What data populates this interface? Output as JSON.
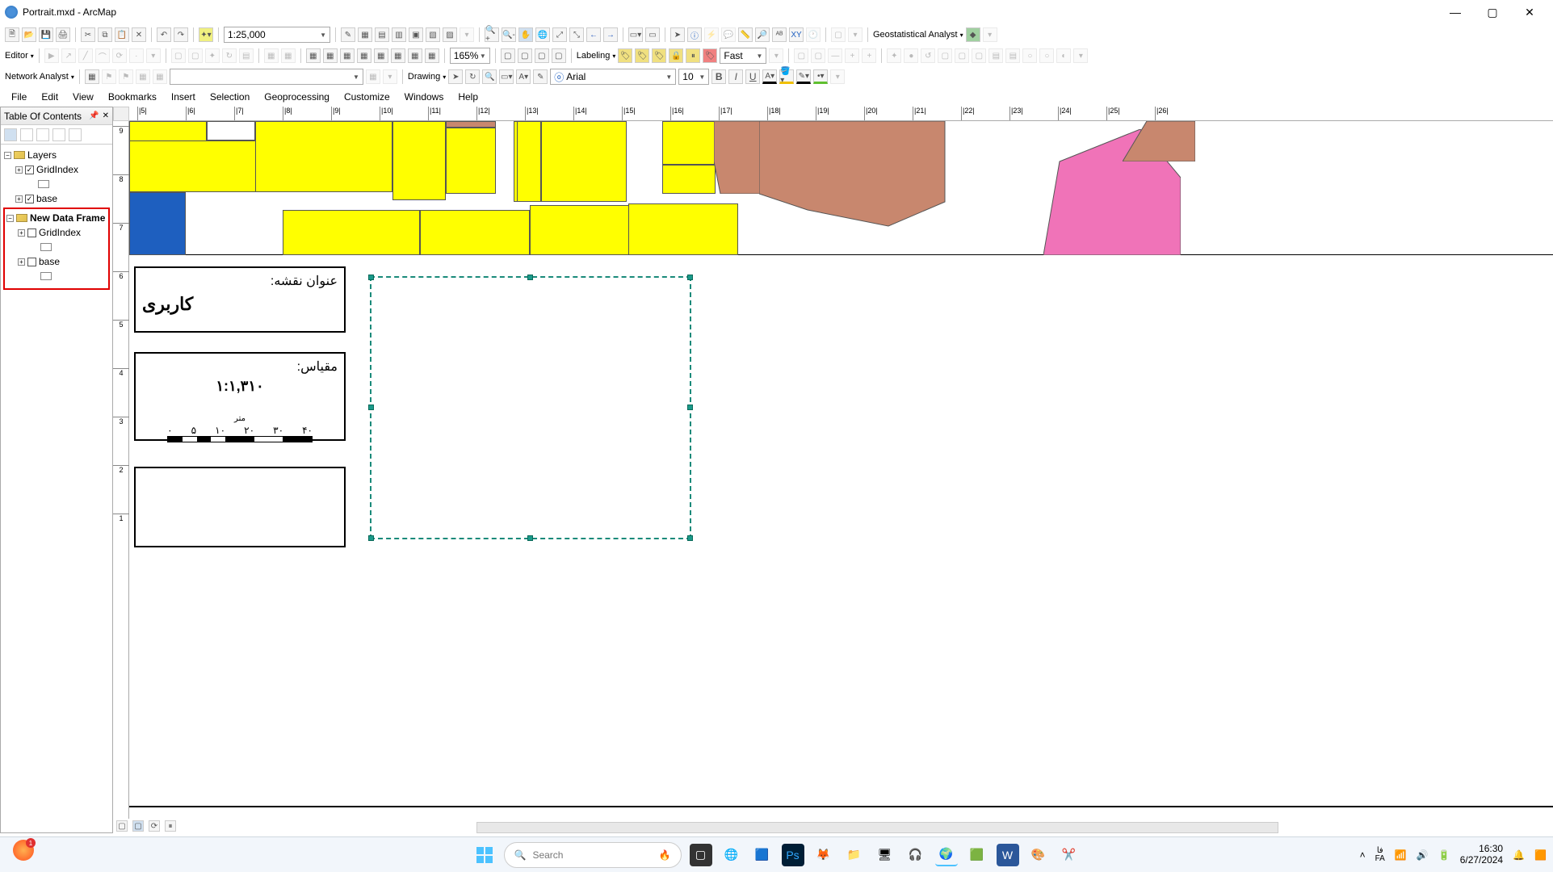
{
  "window": {
    "title": "Portrait.mxd - ArcMap"
  },
  "toolbar1": {
    "scale": "1:25,000",
    "zoom_pct": "165%"
  },
  "toolbar2": {
    "editor": "Editor",
    "labeling": "Labeling",
    "labeling_style": "Fast",
    "geostat": "Geostatistical Analyst",
    "drawing": "Drawing",
    "font": "Arial",
    "font_size": "10",
    "network": "Network Analyst"
  },
  "menu": [
    "File",
    "Edit",
    "View",
    "Bookmarks",
    "Insert",
    "Selection",
    "Geoprocessing",
    "Customize",
    "Windows",
    "Help"
  ],
  "toc": {
    "title": "Table Of Contents",
    "frame1": {
      "name": "Layers",
      "layers": [
        "GridIndex",
        "base"
      ]
    },
    "frame2": {
      "name": "New Data Frame",
      "layers": [
        "GridIndex",
        "base"
      ]
    }
  },
  "layout": {
    "title_label": "عنوان نقشه:",
    "title_value": "کاربری",
    "scale_label": "مقیاس:",
    "scale_value": "۱:۱,۳۱۰",
    "scale_unit": "متر",
    "scale_ticks": [
      "۰",
      "۵",
      "۱۰",
      "۲۰",
      "۳۰",
      "۴۰"
    ]
  },
  "ruler_h": [
    "5",
    "6",
    "7",
    "8",
    "9",
    "10",
    "11",
    "12",
    "13",
    "14",
    "15",
    "16",
    "17",
    "18",
    "19",
    "20",
    "21",
    "22",
    "23",
    "24",
    "25",
    "26"
  ],
  "ruler_v": [
    "9",
    "8",
    "7",
    "6",
    "5",
    "4",
    "3",
    "2",
    "1"
  ],
  "tray": {
    "lang1": "فا",
    "lang2": "FA",
    "time": "16:30",
    "date": "6/27/2024",
    "search": "Search",
    "badge": "1"
  }
}
